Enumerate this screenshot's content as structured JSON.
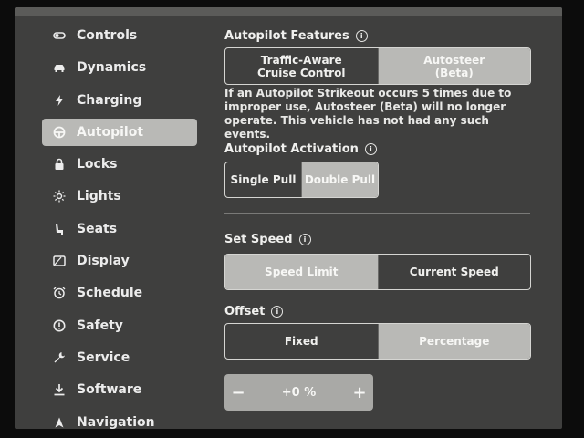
{
  "sidebar": {
    "items": [
      {
        "label": "Controls",
        "icon": "toggle-icon"
      },
      {
        "label": "Dynamics",
        "icon": "car-icon"
      },
      {
        "label": "Charging",
        "icon": "lightning-icon"
      },
      {
        "label": "Autopilot",
        "icon": "steering-wheel-icon"
      },
      {
        "label": "Locks",
        "icon": "lock-icon"
      },
      {
        "label": "Lights",
        "icon": "sun-icon"
      },
      {
        "label": "Seats",
        "icon": "seat-icon"
      },
      {
        "label": "Display",
        "icon": "display-icon"
      },
      {
        "label": "Schedule",
        "icon": "alarm-clock-icon"
      },
      {
        "label": "Safety",
        "icon": "alert-circle-icon"
      },
      {
        "label": "Service",
        "icon": "wrench-icon"
      },
      {
        "label": "Software",
        "icon": "download-icon"
      },
      {
        "label": "Navigation",
        "icon": "navigation-arrow-icon"
      }
    ],
    "active": "Autopilot"
  },
  "autopilot_features": {
    "title": "Autopilot Features",
    "options": [
      "Traffic-Aware\nCruise Control",
      "Autosteer\n(Beta)"
    ],
    "selected": "Autosteer\n(Beta)",
    "warning": "If an Autopilot Strikeout occurs 5 times due to improper use, Autosteer (Beta) will no longer operate. This vehicle has not had any such events."
  },
  "autopilot_activation": {
    "title": "Autopilot Activation",
    "options": [
      "Single Pull",
      "Double Pull"
    ],
    "selected": "Double Pull"
  },
  "set_speed": {
    "title": "Set Speed",
    "options": [
      "Speed Limit",
      "Current Speed"
    ],
    "selected": "Speed Limit"
  },
  "offset": {
    "title": "Offset",
    "options": [
      "Fixed",
      "Percentage"
    ],
    "selected": "Percentage",
    "stepper": {
      "minus": "−",
      "value": "+0 %",
      "plus": "+"
    }
  },
  "colors": {
    "screen_bg": "#3f3f3e",
    "selected_bg": "#b9b9b6",
    "text": "#ececec"
  }
}
